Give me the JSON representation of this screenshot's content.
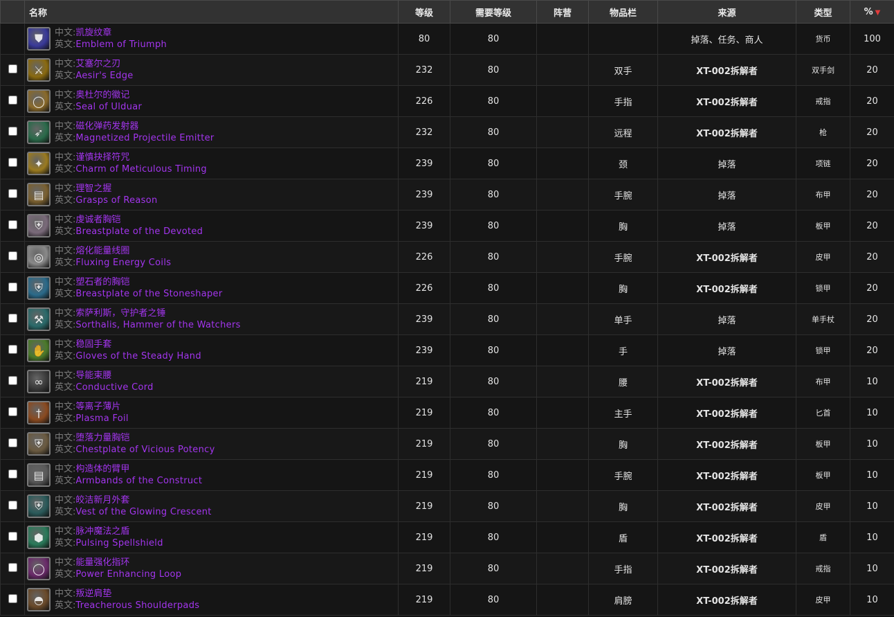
{
  "headers": {
    "name": "名称",
    "level": "等级",
    "req_level": "需要等级",
    "faction": "阵营",
    "slot": "物品栏",
    "source": "来源",
    "type": "类型",
    "percent": "%"
  },
  "label_cn": "中文:",
  "label_en": "英文:",
  "rows": [
    {
      "cn": "凯旋纹章",
      "en": "Emblem of Triumph",
      "level": "80",
      "req": "80",
      "faction": "",
      "slot": "",
      "source": "掉落、任务、商人",
      "type": "货币",
      "pct": "100",
      "checkbox": false,
      "icon": "emblem-icon",
      "icon_color": "#3a3a9a"
    },
    {
      "cn": "艾塞尔之刃",
      "en": "Aesir's Edge",
      "level": "232",
      "req": "80",
      "faction": "",
      "slot": "双手",
      "source": "XT-002拆解者",
      "type": "双手剑",
      "pct": "20",
      "checkbox": true,
      "icon": "sword-icon",
      "icon_color": "#8a6a10"
    },
    {
      "cn": "奥杜尔的徽记",
      "en": "Seal of Ulduar",
      "level": "226",
      "req": "80",
      "faction": "",
      "slot": "手指",
      "source": "XT-002拆解者",
      "type": "戒指",
      "pct": "20",
      "checkbox": true,
      "icon": "ring-icon",
      "icon_color": "#8a6a2a"
    },
    {
      "cn": "磁化弹药发射器",
      "en": "Magnetized Projectile Emitter",
      "level": "232",
      "req": "80",
      "faction": "",
      "slot": "远程",
      "source": "XT-002拆解者",
      "type": "枪",
      "pct": "20",
      "checkbox": true,
      "icon": "gun-icon",
      "icon_color": "#2a6a4a"
    },
    {
      "cn": "谨慎抉择符咒",
      "en": "Charm of Meticulous Timing",
      "level": "239",
      "req": "80",
      "faction": "",
      "slot": "颈",
      "source": "掉落",
      "type": "项链",
      "pct": "20",
      "checkbox": true,
      "icon": "necklace-icon",
      "icon_color": "#9a7a20"
    },
    {
      "cn": "理智之握",
      "en": "Grasps of Reason",
      "level": "239",
      "req": "80",
      "faction": "",
      "slot": "手腕",
      "source": "掉落",
      "type": "布甲",
      "pct": "20",
      "checkbox": true,
      "icon": "bracer-icon",
      "icon_color": "#7a6030"
    },
    {
      "cn": "虔诚者胸铠",
      "en": "Breastplate of the Devoted",
      "level": "239",
      "req": "80",
      "faction": "",
      "slot": "胸",
      "source": "掉落",
      "type": "板甲",
      "pct": "20",
      "checkbox": true,
      "icon": "chest-icon",
      "icon_color": "#7a6a7a"
    },
    {
      "cn": "熔化能量线圈",
      "en": "Fluxing Energy Coils",
      "level": "226",
      "req": "80",
      "faction": "",
      "slot": "手腕",
      "source": "XT-002拆解者",
      "type": "皮甲",
      "pct": "20",
      "checkbox": true,
      "icon": "coil-icon",
      "icon_color": "#8a8a8a"
    },
    {
      "cn": "塑石者的胸铠",
      "en": "Breastplate of the Stoneshaper",
      "level": "226",
      "req": "80",
      "faction": "",
      "slot": "胸",
      "source": "XT-002拆解者",
      "type": "锁甲",
      "pct": "20",
      "checkbox": true,
      "icon": "chest-icon",
      "icon_color": "#2a6a8a"
    },
    {
      "cn": "索萨利斯，守护者之锤",
      "en": "Sorthalis, Hammer of the Watchers",
      "level": "239",
      "req": "80",
      "faction": "",
      "slot": "单手",
      "source": "掉落",
      "type": "单手杖",
      "pct": "20",
      "checkbox": true,
      "icon": "hammer-icon",
      "icon_color": "#2a6a6a"
    },
    {
      "cn": "稳固手套",
      "en": "Gloves of the Steady Hand",
      "level": "239",
      "req": "80",
      "faction": "",
      "slot": "手",
      "source": "掉落",
      "type": "锁甲",
      "pct": "20",
      "checkbox": true,
      "icon": "gloves-icon",
      "icon_color": "#4a7a2a"
    },
    {
      "cn": "导能束腰",
      "en": "Conductive Cord",
      "level": "219",
      "req": "80",
      "faction": "",
      "slot": "腰",
      "source": "XT-002拆解者",
      "type": "布甲",
      "pct": "10",
      "checkbox": true,
      "icon": "belt-icon",
      "icon_color": "#3a3a3a"
    },
    {
      "cn": "等离子薄片",
      "en": "Plasma Foil",
      "level": "219",
      "req": "80",
      "faction": "",
      "slot": "主手",
      "source": "XT-002拆解者",
      "type": "匕首",
      "pct": "10",
      "checkbox": true,
      "icon": "dagger-icon",
      "icon_color": "#8a4a20"
    },
    {
      "cn": "堕落力量胸铠",
      "en": "Chestplate of Vicious Potency",
      "level": "219",
      "req": "80",
      "faction": "",
      "slot": "胸",
      "source": "XT-002拆解者",
      "type": "板甲",
      "pct": "10",
      "checkbox": true,
      "icon": "chest-icon",
      "icon_color": "#6a5a40"
    },
    {
      "cn": "构造体的臂甲",
      "en": "Armbands of the Construct",
      "level": "219",
      "req": "80",
      "faction": "",
      "slot": "手腕",
      "source": "XT-002拆解者",
      "type": "板甲",
      "pct": "10",
      "checkbox": true,
      "icon": "bracer-icon",
      "icon_color": "#5a5a5a"
    },
    {
      "cn": "皎洁新月外套",
      "en": "Vest of the Glowing Crescent",
      "level": "219",
      "req": "80",
      "faction": "",
      "slot": "胸",
      "source": "XT-002拆解者",
      "type": "皮甲",
      "pct": "10",
      "checkbox": true,
      "icon": "vest-icon",
      "icon_color": "#2a5a5a"
    },
    {
      "cn": "脉冲魔法之盾",
      "en": "Pulsing Spellshield",
      "level": "219",
      "req": "80",
      "faction": "",
      "slot": "盾",
      "source": "XT-002拆解者",
      "type": "盾",
      "pct": "10",
      "checkbox": true,
      "icon": "shield-icon",
      "icon_color": "#2a7a5a"
    },
    {
      "cn": "能量强化指环",
      "en": "Power Enhancing Loop",
      "level": "219",
      "req": "80",
      "faction": "",
      "slot": "手指",
      "source": "XT-002拆解者",
      "type": "戒指",
      "pct": "10",
      "checkbox": true,
      "icon": "ring-icon",
      "icon_color": "#6a2a6a"
    },
    {
      "cn": "叛逆肩垫",
      "en": "Treacherous Shoulderpads",
      "level": "219",
      "req": "80",
      "faction": "",
      "slot": "肩膀",
      "source": "XT-002拆解者",
      "type": "皮甲",
      "pct": "10",
      "checkbox": true,
      "icon": "shoulder-icon",
      "icon_color": "#6a4a2a"
    }
  ]
}
